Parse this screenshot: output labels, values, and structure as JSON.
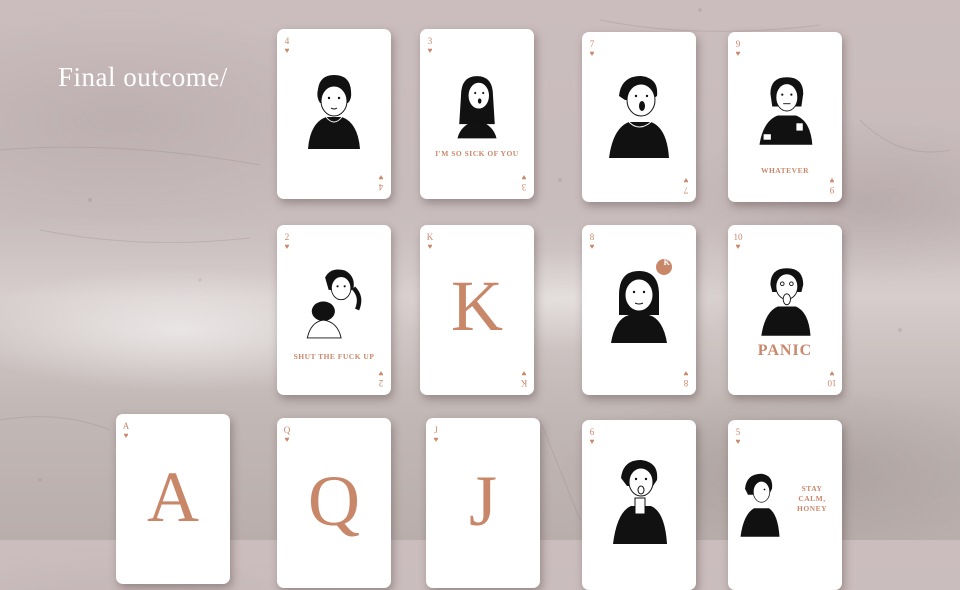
{
  "title": "Final outcome/",
  "accent_color": "#c9876a",
  "suit_symbol": "♥",
  "cards": {
    "c4": {
      "rank": "4",
      "figure": "woman-sitting-illustration"
    },
    "c3": {
      "rank": "3",
      "caption": "I'M SO SICK OF YOU",
      "figure": "woman-long-hair-illustration"
    },
    "c7": {
      "rank": "7",
      "figure": "woman-shouting-illustration"
    },
    "c9": {
      "rank": "9",
      "caption": "WHATEVER",
      "figure": "woman-with-cup-illustration"
    },
    "c2": {
      "rank": "2",
      "caption": "SHUT THE FUCK UP",
      "figure": "woman-ponytail-illustration"
    },
    "cK": {
      "rank": "K",
      "big": "K"
    },
    "c8": {
      "rank": "8",
      "bubble": "K",
      "figure": "woman-speech-bubble-illustration"
    },
    "c10": {
      "rank": "10",
      "caption": "PANIC",
      "figure": "woman-panic-illustration"
    },
    "cA": {
      "rank": "A",
      "big": "A"
    },
    "cQ": {
      "rank": "Q",
      "big": "Q"
    },
    "cJ": {
      "rank": "J",
      "big": "J"
    },
    "c6": {
      "rank": "6",
      "figure": "woman-eating-illustration"
    },
    "c5": {
      "rank": "5",
      "caption_lines": [
        "STAY",
        "CALM,",
        "HONEY"
      ],
      "figure": "woman-side-profile-illustration"
    }
  }
}
